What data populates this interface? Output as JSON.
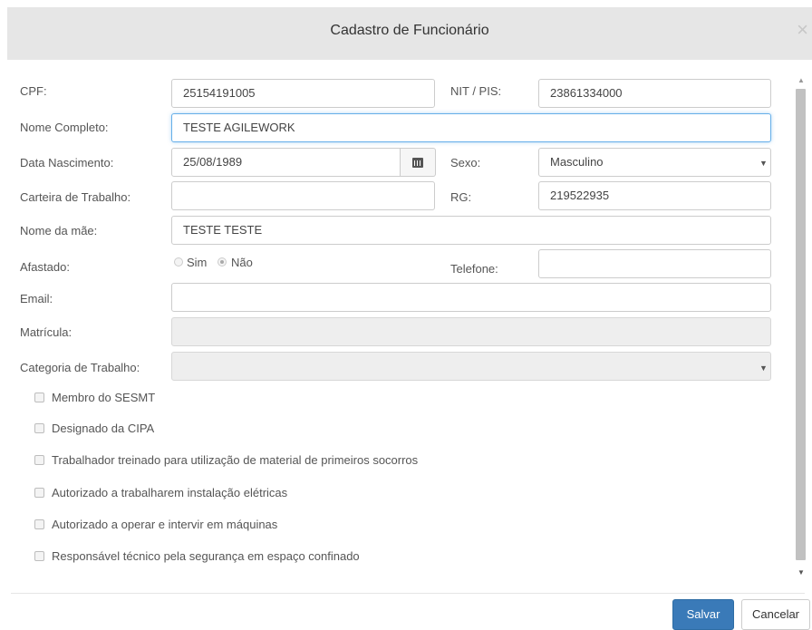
{
  "modal": {
    "title": "Cadastro de Funcionário",
    "close_glyph": "×"
  },
  "form": {
    "cpf": {
      "label": "CPF:",
      "value": "25154191005"
    },
    "nit": {
      "label": "NIT / PIS:",
      "value": "23861334000"
    },
    "nome": {
      "label": "Nome Completo:",
      "value": "TESTE AGILEWORK"
    },
    "nascimento": {
      "label": "Data Nascimento:",
      "value": "25/08/1989"
    },
    "sexo": {
      "label": "Sexo:",
      "value": "Masculino"
    },
    "carteira": {
      "label": "Carteira de Trabalho:",
      "value": ""
    },
    "rg": {
      "label": "RG:",
      "value": "219522935"
    },
    "mae": {
      "label": "Nome da mãe:",
      "value": "TESTE TESTE"
    },
    "afastado": {
      "label": "Afastado:",
      "option_sim": "Sim",
      "option_nao": "Não",
      "selected": "Não"
    },
    "telefone": {
      "label": "Telefone:",
      "value": ""
    },
    "email": {
      "label": "Email:",
      "value": ""
    },
    "matricula": {
      "label": "Matrícula:",
      "value": ""
    },
    "categoria": {
      "label": "Categoria de Trabalho:",
      "value": ""
    }
  },
  "checkboxes": [
    {
      "label": "Membro do SESMT",
      "checked": false
    },
    {
      "label": "Designado da CIPA",
      "checked": false
    },
    {
      "label": "Trabalhador treinado para utilização de material de primeiros socorros",
      "checked": false
    },
    {
      "label": "Autorizado a trabalharem instalação elétricas",
      "checked": false
    },
    {
      "label": "Autorizado a operar e intervir em máquinas",
      "checked": false
    },
    {
      "label": "Responsável técnico pela segurança em espaço confinado",
      "checked": false
    }
  ],
  "footer": {
    "save_label": "Salvar",
    "cancel_label": "Cancelar"
  },
  "colors": {
    "primary": "#3a7ab8",
    "header_bg": "#e6e6e6",
    "focus_border": "#66afe9"
  }
}
